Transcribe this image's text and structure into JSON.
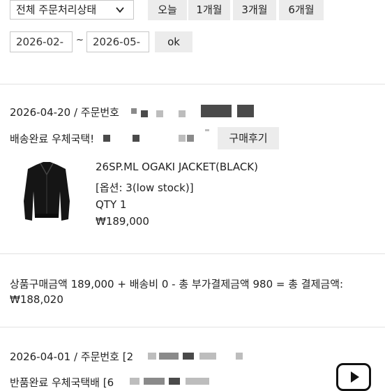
{
  "filter": {
    "status_select": "전체 주문처리상태",
    "period_buttons": [
      "오늘",
      "1개월",
      "3개월",
      "6개월"
    ],
    "date_from": "2026-02-",
    "date_sep": "~",
    "date_to": "2026-05-",
    "ok_label": "ok"
  },
  "orders": [
    {
      "date_line": "2026-04-20 / 주문번호",
      "status_line": "배송완료 우체국택!",
      "review_label": "구매후기",
      "product": {
        "name": "26SP.ML OGAKI JACKET(BLACK)",
        "option": "[옵션: 3(low stock)]",
        "qty": "QTY 1",
        "price": "₩189,000"
      },
      "summary_line1": "상품구매금액 189,000 + 배송비 0 - 총 부가결제금액 980 = 총 결제금액:",
      "summary_line2": "₩188,020"
    },
    {
      "date_line": "2026-04-01 / 주문번호 [2",
      "status_line": "반품완료 우체국택배 [6"
    }
  ],
  "icons": {
    "chevron": "chevron-down-icon",
    "play": "play-icon"
  }
}
